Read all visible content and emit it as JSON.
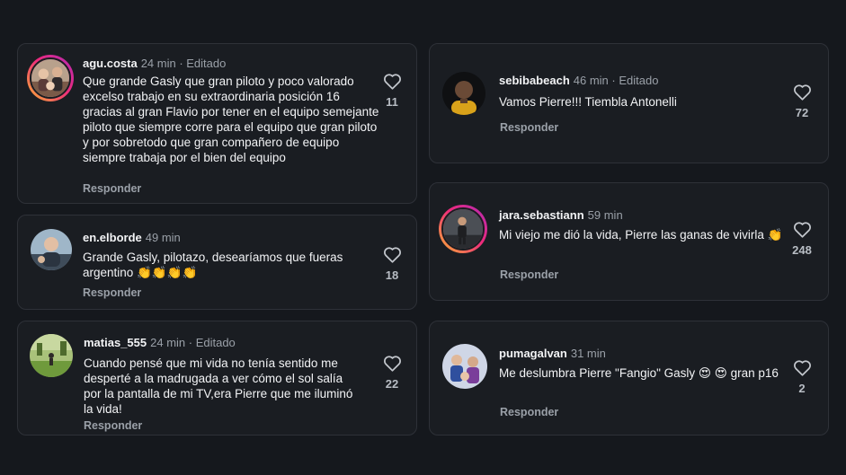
{
  "comments": [
    {
      "username": "agu.costa",
      "time": "24 min · Editado",
      "text": "Que grande Gasly que gran piloto y poco valorado excelso trabajo en su extraordinaria posición 16 gracias al gran Flavio por tener en el equipo semejante piloto que siempre corre para el equipo que gran piloto y por sobretodo que gran compañero de equipo siempre trabaja por el bien del equipo",
      "reply": "Responder",
      "likes": "11"
    },
    {
      "username": "en.elborde",
      "time": "49 min",
      "text": "Grande Gasly, pilotazo, desearíamos que fueras argentino 👏👏👏👏",
      "reply": "Responder",
      "likes": "18"
    },
    {
      "username": "matias_555",
      "time": "24 min · Editado",
      "text": "Cuando pensé que mi vida no tenía sentido me desperté a la madrugada a ver cómo el sol salía por la pantalla de mi TV,era Pierre que me iluminó la vida!",
      "reply": "Responder",
      "likes": "22"
    },
    {
      "username": "sebibabeach",
      "time": "46 min · Editado",
      "text": "Vamos Pierre!!! Tiembla Antonelli",
      "reply": "Responder",
      "likes": "72"
    },
    {
      "username": "jara.sebastiann",
      "time": "59 min",
      "text": "Mi viejo me dió la vida, Pierre las ganas de vivirla 👏",
      "reply": "Responder",
      "likes": "248"
    },
    {
      "username": "pumagalvan",
      "time": "31 min",
      "text": "Me deslumbra Pierre \"Fangio\" Gasly 😍 😍 gran p16",
      "reply": "Responder",
      "likes": "2"
    }
  ],
  "icons": {
    "like": "heart-outline-icon"
  },
  "colors": {
    "background": "#15181d",
    "card": "#1a1d22",
    "border": "#2e3138",
    "muted_text": "#9aa0a8",
    "story_ring_start": "#f9b233",
    "story_ring_end": "#b02ab5"
  }
}
